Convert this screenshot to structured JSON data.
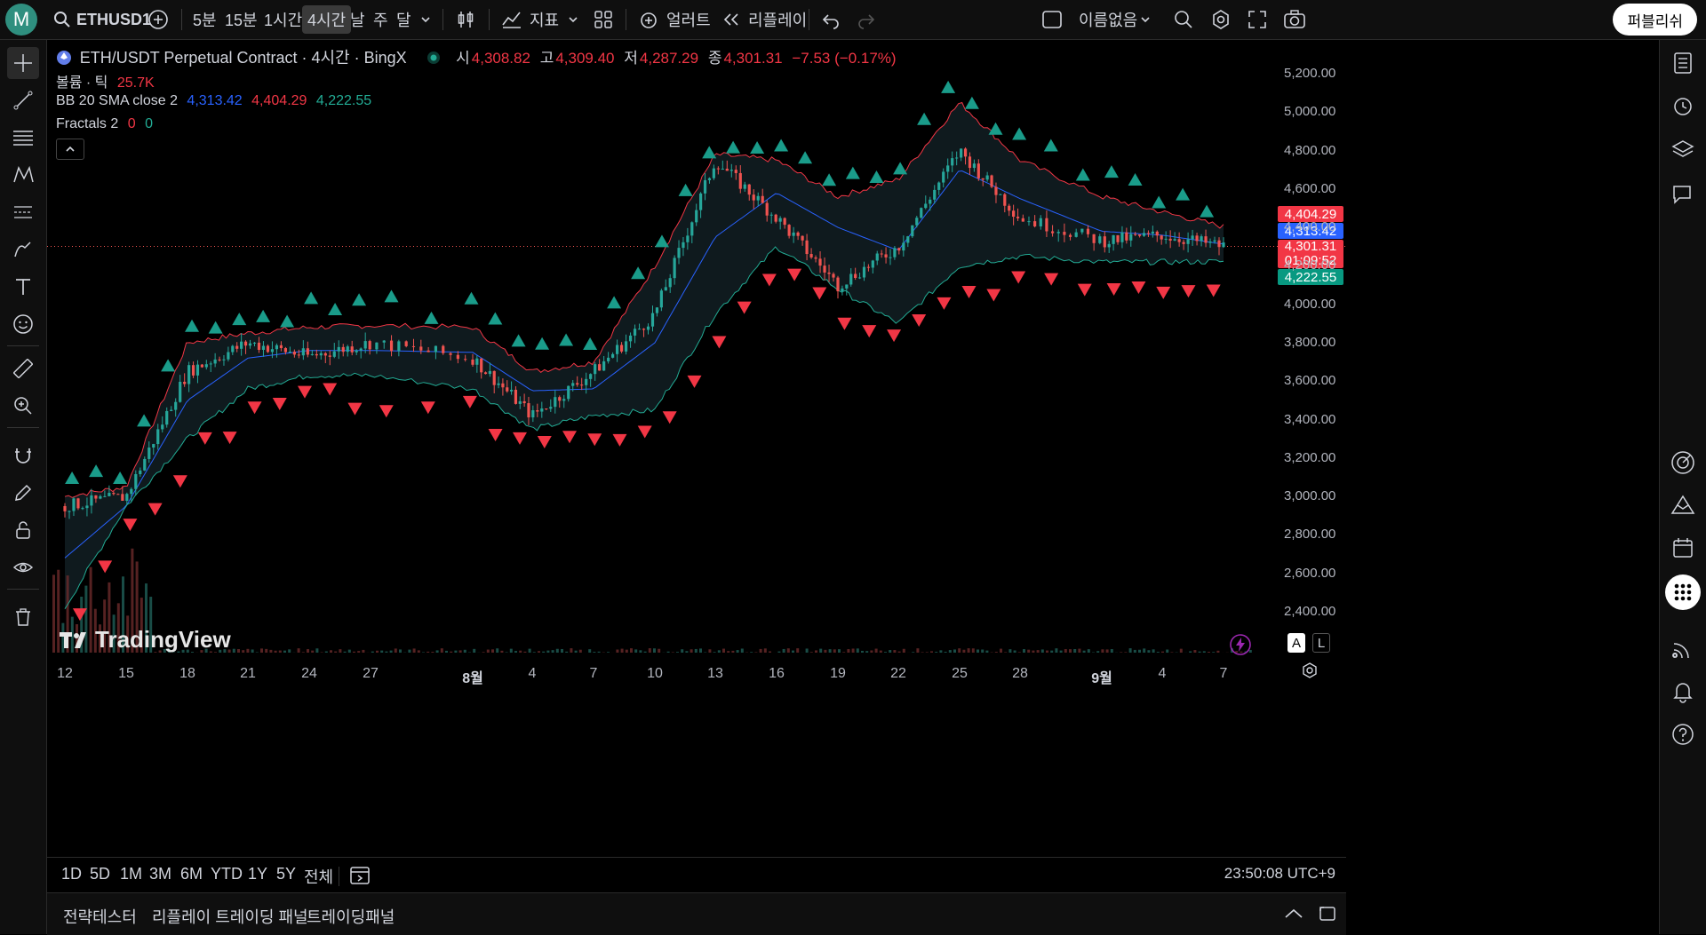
{
  "topbar": {
    "avatar_letter": "M",
    "symbol": "ETHUSD1",
    "timeframes": [
      "5분",
      "15분",
      "1시간",
      "4시간",
      "날",
      "주",
      "달"
    ],
    "active_timeframe": "4시간",
    "indicators_label": "지표",
    "alerts_label": "얼러트",
    "replay_label": "리플레이",
    "layout_name": "이름없음",
    "publish_label": "퍼블리쉬"
  },
  "legend": {
    "title": "ETH/USDT Perpetual Contract · 4시간 · BingX",
    "ohlc": {
      "o_label": "시",
      "o": "4,308.82",
      "h_label": "고",
      "h": "4,309.40",
      "l_label": "저",
      "l": "4,287.29",
      "c_label": "종",
      "c": "4,301.31",
      "change": "−7.53 (−0.17%)"
    },
    "volume_label": "볼륨 · 틱",
    "volume_value": "25.7K",
    "bb_label": "BB 20 SMA close 2",
    "bb_basis": "4,313.42",
    "bb_upper": "4,404.29",
    "bb_lower": "4,222.55",
    "fractals_label": "Fractals 2",
    "fractals_up": "0",
    "fractals_down": "0"
  },
  "price_tags": {
    "upper": "4,404.29",
    "basis": "4,313.42",
    "last": "4,301.31",
    "countdown": "01:09:52",
    "lower": "4,222.55"
  },
  "y_axis_labels": [
    "5,200.00",
    "5,000.00",
    "4,800.00",
    "4,600.00",
    "4,400.00",
    "4,200.00",
    "4,000.00",
    "3,800.00",
    "3,600.00",
    "3,400.00",
    "3,200.00",
    "3,000.00",
    "2,800.00",
    "2,600.00",
    "2,400.00"
  ],
  "x_axis_labels": [
    "12",
    "15",
    "18",
    "21",
    "24",
    "27",
    "8월",
    "4",
    "7",
    "10",
    "13",
    "16",
    "19",
    "22",
    "25",
    "28",
    "9월",
    "4",
    "7"
  ],
  "scale_buttons": [
    "A",
    "L"
  ],
  "branding": "TradingView",
  "range_bar": {
    "ranges": [
      "1D",
      "5D",
      "1M",
      "3M",
      "6M",
      "YTD",
      "1Y",
      "5Y",
      "전체"
    ],
    "clock": "23:50:08 UTC+9"
  },
  "bottom_panel": {
    "tabs": [
      "전략테스터",
      "리플레이 트레이딩 패널",
      "트레이딩패널"
    ]
  },
  "colors": {
    "up": "#26a69a",
    "down": "#ef5350",
    "bb_upper": "#f23645",
    "bb_basis": "#2962ff",
    "bb_lower": "#22ab94",
    "fractal_up": "#1a9c8a",
    "fractal_down": "#f23645"
  },
  "chart_data": {
    "type": "candlestick",
    "symbol": "ETH/USDT Perpetual Contract",
    "interval": "4시간",
    "exchange": "BingX",
    "ylim": [
      2300,
      5300
    ],
    "grid": false,
    "close_path": [
      [
        "12",
        2950
      ],
      [
        "15",
        3000
      ],
      [
        "18",
        3650
      ],
      [
        "21",
        3800
      ],
      [
        "24",
        3730
      ],
      [
        "27",
        3800
      ],
      [
        "8월",
        3720
      ],
      [
        "4",
        3420
      ],
      [
        "7",
        3650
      ],
      [
        "10",
        3950
      ],
      [
        "13",
        4750
      ],
      [
        "16",
        4450
      ],
      [
        "19",
        4100
      ],
      [
        "22",
        4300
      ],
      [
        "25",
        4800
      ],
      [
        "28",
        4450
      ],
      [
        "9월",
        4330
      ],
      [
        "4",
        4360
      ],
      [
        "7",
        4301.31
      ]
    ],
    "bollinger": {
      "upper": [
        [
          "12",
          3000
        ],
        [
          "15",
          3050
        ],
        [
          "18",
          3800
        ],
        [
          "21",
          3850
        ],
        [
          "24",
          3880
        ],
        [
          "27",
          3890
        ],
        [
          "8월",
          3880
        ],
        [
          "4",
          3650
        ],
        [
          "7",
          3700
        ],
        [
          "10",
          4200
        ],
        [
          "13",
          4780
        ],
        [
          "16",
          4750
        ],
        [
          "19",
          4560
        ],
        [
          "22",
          4650
        ],
        [
          "25",
          5050
        ],
        [
          "28",
          4750
        ],
        [
          "9월",
          4560
        ],
        [
          "4",
          4480
        ],
        [
          "7",
          4404.29
        ]
      ],
      "basis": [
        [
          "12",
          2680
        ],
        [
          "15",
          2950
        ],
        [
          "18",
          3500
        ],
        [
          "21",
          3720
        ],
        [
          "24",
          3760
        ],
        [
          "27",
          3760
        ],
        [
          "8월",
          3750
        ],
        [
          "4",
          3550
        ],
        [
          "7",
          3560
        ],
        [
          "10",
          3800
        ],
        [
          "13",
          4350
        ],
        [
          "16",
          4580
        ],
        [
          "19",
          4400
        ],
        [
          "22",
          4280
        ],
        [
          "25",
          4700
        ],
        [
          "28",
          4550
        ],
        [
          "9월",
          4380
        ],
        [
          "4",
          4360
        ],
        [
          "7",
          4313.42
        ]
      ],
      "lower": [
        [
          "12",
          2420
        ],
        [
          "15",
          2950
        ],
        [
          "18",
          3300
        ],
        [
          "21",
          3560
        ],
        [
          "24",
          3630
        ],
        [
          "27",
          3630
        ],
        [
          "8월",
          3560
        ],
        [
          "4",
          3350
        ],
        [
          "7",
          3420
        ],
        [
          "10",
          3450
        ],
        [
          "13",
          3950
        ],
        [
          "16",
          4300
        ],
        [
          "19",
          4080
        ],
        [
          "22",
          3900
        ],
        [
          "25",
          4200
        ],
        [
          "28",
          4250
        ],
        [
          "9월",
          4220
        ],
        [
          "4",
          4220
        ],
        [
          "7",
          4222.55
        ]
      ]
    },
    "fractal_up_count": 46,
    "fractal_down_count": 44,
    "last_price": 4301.31
  }
}
